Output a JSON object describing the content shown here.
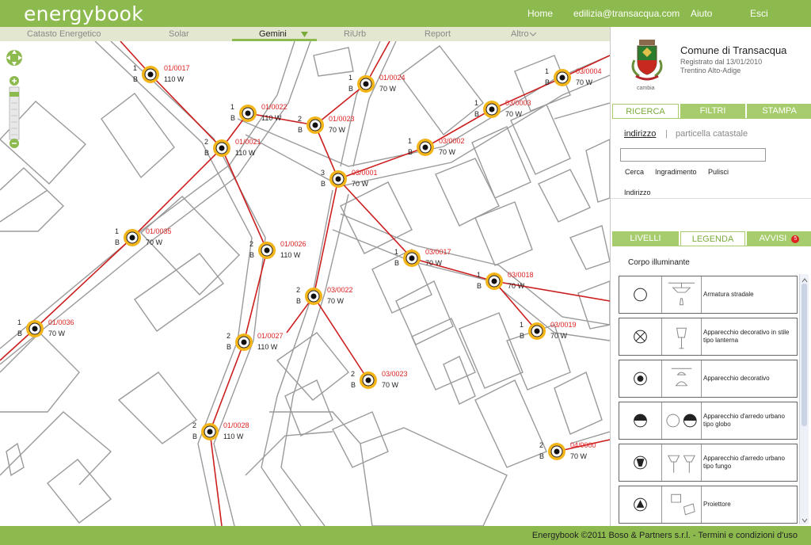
{
  "app": {
    "logo": "energybook"
  },
  "topnav": [
    {
      "label": "Home"
    },
    {
      "label": "edilizia@transacqua.com"
    },
    {
      "label": "Aiuto"
    },
    {
      "label": "Esci"
    }
  ],
  "tabs": [
    {
      "label": "Catasto Energetico"
    },
    {
      "label": "Solar"
    },
    {
      "label": "Gemini"
    },
    {
      "label": "RiUrb"
    },
    {
      "label": "Report"
    },
    {
      "label": "Altro"
    }
  ],
  "municipality": {
    "name": "Comune di Transacqua",
    "registered": "Registrato dal 13/01/2010",
    "region": "Trentino Alto-Adige",
    "change_label": "cambia"
  },
  "search_panel": {
    "tabs": [
      "RICERCA",
      "FILTRI",
      "STAMPA"
    ],
    "mode_address": "indirizzo",
    "mode_separator": "|",
    "mode_parcel": "particella catastale",
    "input_value": "",
    "cerca": "Cerca",
    "ingrandimento": "Ingradimento",
    "pulisci": "Pulisci",
    "result_label": "Indirizzo"
  },
  "legend_panel": {
    "tabs": [
      "LIVELLI",
      "LEGENDA",
      "AVVISI"
    ],
    "alert_count": "5",
    "section_title": "Corpo illuminante",
    "items": [
      {
        "label": "Armatura stradale",
        "symbol": "circle-empty-icon"
      },
      {
        "label": "Apparecchio decorativo in stile tipo lanterna",
        "symbol": "circle-cross-icon"
      },
      {
        "label": "Apparecchio decorativo",
        "symbol": "circle-dot-icon"
      },
      {
        "label": "Apparecchio d'arredo urbano tipo globo",
        "symbol": "circle-half-icon"
      },
      {
        "label": "Apparecchio d'arredo urbano tipo fungo",
        "symbol": "circle-trapezoid-icon"
      },
      {
        "label": "Proiettore",
        "symbol": "circle-triangle-icon"
      }
    ]
  },
  "lamps": [
    {
      "n": "1",
      "t": "B",
      "id": "01/0017",
      "w": "110 W"
    },
    {
      "n": "1",
      "t": "B",
      "id": "01/0022",
      "w": "110 W"
    },
    {
      "n": "2",
      "t": "B",
      "id": "01/0023",
      "w": "70 W"
    },
    {
      "n": "1",
      "t": "B",
      "id": "01/0024",
      "w": "70 W"
    },
    {
      "n": "2",
      "t": "B",
      "id": "01/0021",
      "w": "110 W"
    },
    {
      "n": "1",
      "t": "B",
      "id": "01/0035",
      "w": "70 W"
    },
    {
      "n": "2",
      "t": "B",
      "id": "01/0026",
      "w": "110 W"
    },
    {
      "n": "1",
      "t": "B",
      "id": "01/0036",
      "w": "70 W"
    },
    {
      "n": "2",
      "t": "B",
      "id": "01/0027",
      "w": "110 W"
    },
    {
      "n": "2",
      "t": "B",
      "id": "01/0028",
      "w": "110 W"
    },
    {
      "n": "3",
      "t": "B",
      "id": "03/0001",
      "w": "70 W"
    },
    {
      "n": "1",
      "t": "B",
      "id": "03/0002",
      "w": "70 W"
    },
    {
      "n": "1",
      "t": "B",
      "id": "03/0003",
      "w": "70 W"
    },
    {
      "n": "1",
      "t": "B",
      "id": "03/0004",
      "w": "70 W"
    },
    {
      "n": "1",
      "t": "B",
      "id": "03/0017",
      "w": "70 W"
    },
    {
      "n": "1",
      "t": "B",
      "id": "03/0018",
      "w": "70 W"
    },
    {
      "n": "1",
      "t": "B",
      "id": "03/0019",
      "w": "70 W"
    },
    {
      "n": "2",
      "t": "B",
      "id": "03/0022",
      "w": "70 W"
    },
    {
      "n": "2",
      "t": "B",
      "id": "03/0023",
      "w": "70 W"
    },
    {
      "n": "2",
      "t": "B",
      "id": "04/0000",
      "w": "70 W"
    }
  ],
  "footer": {
    "text": "Energybook ©2011 Boso & Partners s.r.l. - Termini e condizioni d'uso"
  },
  "colors": {
    "brand": "#8dba4e",
    "lamp": "#f2b418",
    "line": "#cc1f1f"
  }
}
